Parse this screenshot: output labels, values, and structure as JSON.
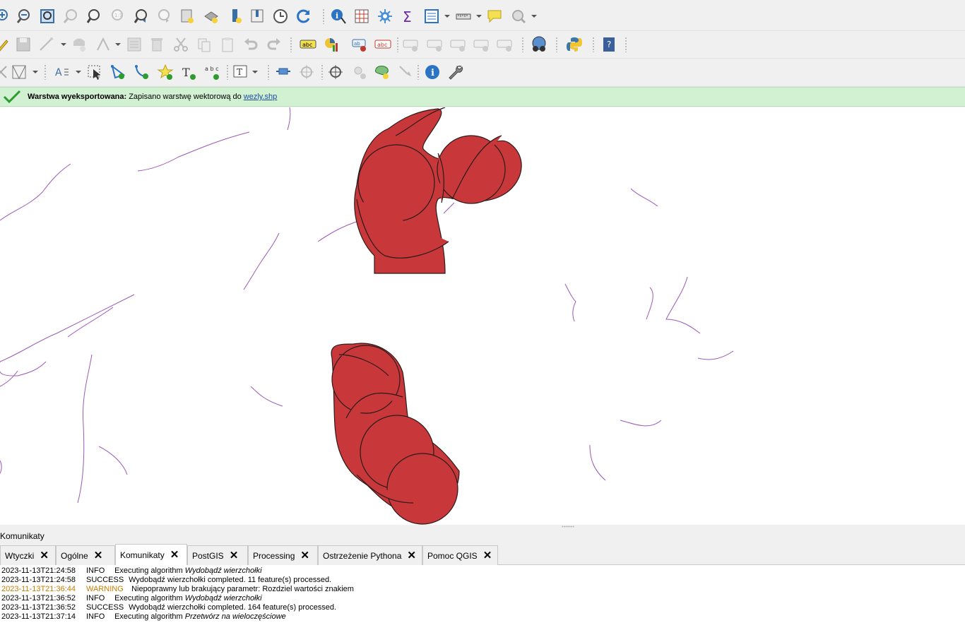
{
  "message_bar": {
    "title": "Warstwa wyeksportowana:",
    "body": "Zapisano warstwę wektorową do",
    "link": "wezly.shp",
    "success_color": "#2e9b2e"
  },
  "dock": {
    "title": "Komunikaty"
  },
  "tabs": [
    {
      "label": "Wtyczki"
    },
    {
      "label": "Ogólne"
    },
    {
      "label": "Komunikaty",
      "active": true
    },
    {
      "label": "PostGIS"
    },
    {
      "label": "Processing"
    },
    {
      "label": "Ostrzeżenie Pythona"
    },
    {
      "label": "Pomoc QGIS"
    }
  ],
  "log": [
    {
      "ts": "2023-11-13T21:24:58",
      "level": "INFO",
      "msg": "Executing algorithm",
      "alg": "Wydobądź wierzchołki"
    },
    {
      "ts": "2023-11-13T21:24:58",
      "level": "SUCCESS",
      "msg": "Wydobądź wierzchołki completed. 11 feature(s) processed.",
      "alg": ""
    },
    {
      "ts": "2023-11-13T21:36:44",
      "level": "WARNING",
      "msg": "Niepoprawny lub brakujący parametr: Rozdziel wartości znakiem",
      "alg": ""
    },
    {
      "ts": "2023-11-13T21:36:52",
      "level": "INFO",
      "msg": "Executing algorithm",
      "alg": "Wydobądź wierzchołki"
    },
    {
      "ts": "2023-11-13T21:36:52",
      "level": "SUCCESS",
      "msg": "Wydobądź wierzchołki completed. 164 feature(s) processed.",
      "alg": ""
    },
    {
      "ts": "2023-11-13T21:37:14",
      "level": "INFO",
      "msg": "Executing algorithm",
      "alg": "Przetwórz na wieloczęściowe"
    }
  ],
  "map": {
    "polygon_fill": "#c8383a",
    "line_color": "#9b59b6"
  },
  "toolbar_icons": {
    "row1": [
      "zoom-in-icon",
      "zoom-out-icon",
      "zoom-full-icon",
      "zoom-selection-icon",
      "zoom-layer-icon",
      "zoom-native-icon",
      "zoom-last-icon",
      "zoom-next-icon",
      "new-bookmark-icon",
      "show-bookmarks-icon",
      "decorations-icon",
      "spatial-bookmark-icon",
      "temporal-controller-icon",
      "refresh-icon",
      "identify-icon",
      "attribute-table-icon",
      "statistics-gear-icon",
      "sum-icon",
      "open-attribute-table-icon",
      "measure-icon",
      "map-tips-icon",
      "select-by-location-icon"
    ],
    "row2": [
      "toggle-editing-icon",
      "save-edits-icon",
      "digitize-icon",
      "add-feature-icon",
      "vertex-tool-icon",
      "modify-attributes-icon",
      "delete-selected-icon",
      "cut-features-icon",
      "copy-features-icon",
      "paste-features-icon",
      "undo-icon",
      "redo-icon",
      "label-abc-icon",
      "diagram-icon",
      "label-pin-icon",
      "label-highlight-icon",
      "label-show-hide-icon",
      "label-move-icon",
      "label-rotate-icon",
      "label-change-icon",
      "label-unpin-icon",
      "georeferencer-icon",
      "python-console-icon",
      "help-icon"
    ],
    "row3": [
      "digitize-shape-icon",
      "annotation-text-icon",
      "select-features-icon",
      "add-polygon-vertex-icon",
      "add-line-vertex-icon",
      "add-star-icon",
      "text-annotation-icon",
      "abc-label-icon",
      "text-tool-icon",
      "move-item-icon",
      "crosshair-icon",
      "coordinate-capture-icon",
      "add-point-icon",
      "add-polygon-icon",
      "pan-icon",
      "info-icon",
      "wrench-icon"
    ]
  }
}
